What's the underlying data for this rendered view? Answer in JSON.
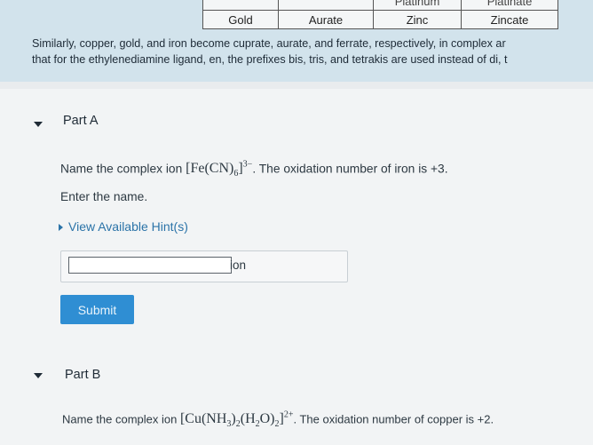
{
  "table": {
    "row_partial": [
      "Platinum",
      "Platinate"
    ],
    "row": [
      "Gold",
      "Aurate",
      "Zinc",
      "Zincate"
    ]
  },
  "intro": {
    "line1": "Similarly, copper, gold, and iron become cuprate, aurate, and ferrate, respectively, in complex ar",
    "line2": "that for the ethylenediamine ligand, en, the prefixes bis, tris, and tetrakis are used instead of di, t"
  },
  "part_a": {
    "title": "Part A",
    "prompt_prefix": "Name the complex ion",
    "formula": {
      "open": "[Fe(CN)",
      "sub": "6",
      "close": "]",
      "charge": "3−"
    },
    "prompt_suffix": ". The oxidation number of iron is +3.",
    "instruction": "Enter the name.",
    "hint_label": "View Available Hint(s)",
    "input_value": "",
    "input_unit": "ion",
    "submit_label": "Submit"
  },
  "part_b": {
    "title": "Part B",
    "prompt_prefix": "Name the complex ion",
    "formula": {
      "p1": "[Cu(NH",
      "s1": "3",
      "p2": ")",
      "s2": "2",
      "p3": "(H",
      "s3": "2",
      "p4": "O)",
      "s4": "2",
      "p5": "]",
      "charge": "2+"
    },
    "prompt_suffix": ". The oxidation number of copper is +2."
  },
  "colors": {
    "accent": "#2f8ed3",
    "link": "#2b73a8"
  }
}
